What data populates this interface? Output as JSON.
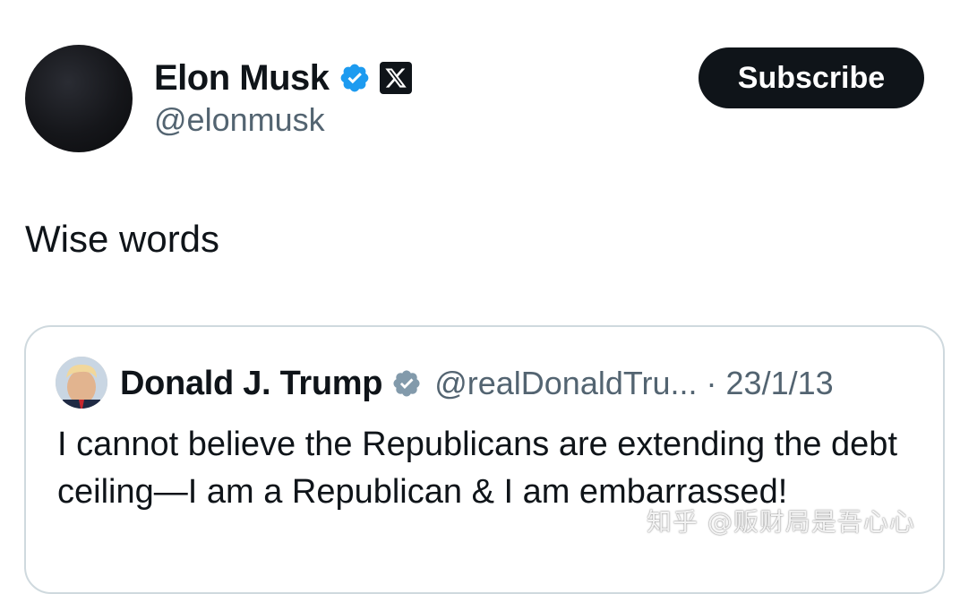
{
  "post": {
    "author": {
      "display_name": "Elon Musk",
      "handle": "@elonmusk",
      "verified": true,
      "affiliate_badge": "x-logo-icon"
    },
    "subscribe_label": "Subscribe",
    "text": "Wise words"
  },
  "quoted_post": {
    "author": {
      "display_name": "Donald J. Trump",
      "handle": "@realDonaldTru...",
      "verified": true
    },
    "separator": "·",
    "date": "23/1/13",
    "text": "I cannot believe the Republicans are extending the debt ceiling—I am a Republican & I am embarrassed!"
  },
  "watermark": {
    "text": "知乎 @贩财局是吾心心"
  },
  "colors": {
    "text_primary": "#0f1419",
    "text_secondary": "#536471",
    "verified_blue": "#1d9bf0",
    "verified_gray": "#829aab",
    "border": "#cfd9de",
    "button_bg": "#0f1419"
  }
}
